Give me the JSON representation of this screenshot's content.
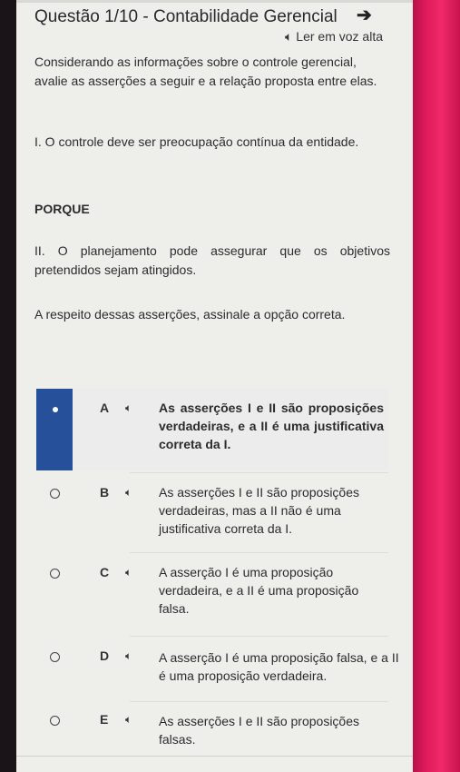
{
  "question": {
    "title": "Questão 1/10 - Contabilidade Gerencial",
    "listen_label": "Ler em voz alta",
    "intro": "Considerando as informações sobre o controle gerencial, avalie as asserções a seguir e a relação proposta entre elas.",
    "assertion_1": "I. O controle deve ser preocupação contínua da entidade.",
    "connector": "PORQUE",
    "assertion_2": "II. O planejamento pode assegurar que os objetivos pretendidos sejam atingidos.",
    "prompt": "A respeito dessas asserções, assinale a opção correta."
  },
  "options": [
    {
      "letter": "A",
      "text": "As asserções I e II são proposições verdadeiras, e a II é uma justificativa correta da I.",
      "selected": true
    },
    {
      "letter": "B",
      "text": "As asserções I e II são proposições verdadeiras, mas a II não é uma justificativa correta da I.",
      "selected": false
    },
    {
      "letter": "C",
      "text": "A asserção I é uma proposição verdadeira, e a II é uma proposição falsa.",
      "selected": false
    },
    {
      "letter": "D",
      "text": "A asserção I é uma proposição falsa, e a II é uma proposição verdadeira.",
      "selected": false
    },
    {
      "letter": "E",
      "text": "As asserções I e II são proposições falsas.",
      "selected": false
    }
  ],
  "icons": {
    "speaker": "speaker-icon",
    "arrow": "arrow-right-icon"
  },
  "colors": {
    "selected_accent": "#26509a",
    "device_edge": "#e01c5e"
  }
}
